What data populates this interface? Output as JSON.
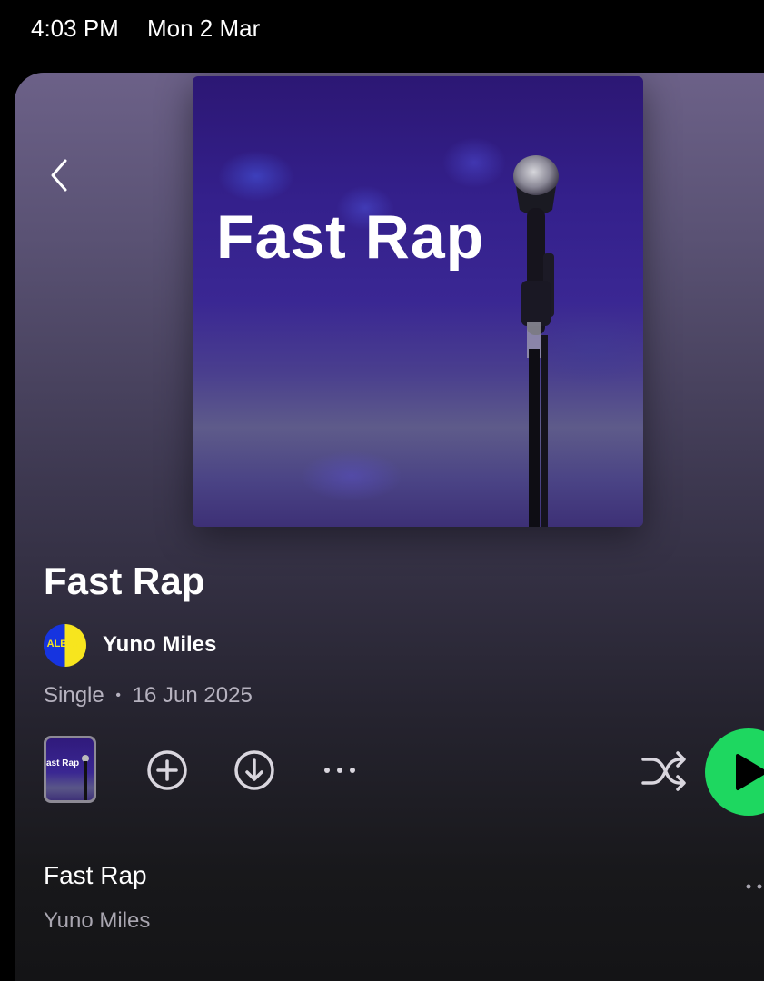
{
  "status_bar": {
    "time": "4:03 PM",
    "date": "Mon 2 Mar"
  },
  "cover": {
    "title": "Fast Rap"
  },
  "track": {
    "title": "Fast Rap",
    "artist": "Yuno Miles",
    "artist_avatar_text": "ALBUM",
    "type": "Single",
    "separator": "•",
    "release_date": "16 Jun 2025"
  },
  "mini_cover": {
    "title": "ast Rap"
  },
  "tracklist": [
    {
      "title": "Fast Rap",
      "artist": "Yuno Miles"
    }
  ],
  "colors": {
    "accent": "#1ed760",
    "icon": "#d9d6de",
    "secondary_text": "#b6b2bf"
  },
  "icons": [
    "chevron-left-icon",
    "add-circle-icon",
    "download-circle-icon",
    "more-horizontal-icon",
    "shuffle-icon",
    "play-icon"
  ]
}
